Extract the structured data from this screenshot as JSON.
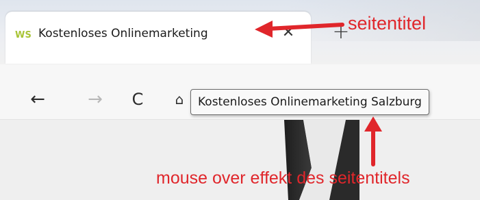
{
  "browser": {
    "tab": {
      "favicon_text": "WS",
      "title": "Kostenloses Onlinemarketing",
      "close_symbol": "✕"
    },
    "new_tab_symbol": "+",
    "toolbar": {
      "back_symbol": "←",
      "forward_symbol": "→",
      "reload_symbol": "C",
      "home_symbol": "⌂"
    },
    "tooltip": "Kostenloses Onlinemarketing Salzburg"
  },
  "annotations": {
    "tab_title_note": "seitentitel",
    "hover_note": "mouse over effekt des seitentitels",
    "color": "#e0262b"
  }
}
